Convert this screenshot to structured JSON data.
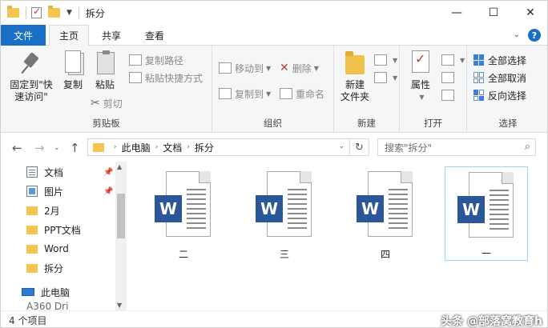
{
  "window": {
    "title": "拆分",
    "controls": {
      "minimize": "—",
      "maximize": "☐",
      "close": "✕"
    }
  },
  "tabs": [
    {
      "label": "文件",
      "active": false
    },
    {
      "label": "主页",
      "active": true
    },
    {
      "label": "共享",
      "active": false
    },
    {
      "label": "查看",
      "active": false
    }
  ],
  "ribbon": {
    "clipboard": {
      "label": "剪贴板",
      "pin_quick": "固定到\"快\n速访问\"",
      "copy": "复制",
      "paste": "粘贴",
      "copy_path": "复制路径",
      "paste_shortcut": "粘贴快捷方式",
      "cut": "剪切"
    },
    "organize": {
      "label": "组织",
      "move_to": "移动到",
      "copy_to": "复制到",
      "delete": "删除",
      "rename": "重命名"
    },
    "new": {
      "label": "新建",
      "new_folder": "新建\n文件夹"
    },
    "open": {
      "label": "打开",
      "properties": "属性"
    },
    "select": {
      "label": "选择",
      "select_all": "全部选择",
      "select_none": "全部取消",
      "invert": "反向选择"
    }
  },
  "address": {
    "crumbs": [
      "此电脑",
      "文档",
      "拆分"
    ],
    "search_placeholder": "搜索\"拆分\""
  },
  "nav_pane": {
    "items": [
      {
        "label": "文档",
        "icon": "document-icon",
        "pinned": true
      },
      {
        "label": "图片",
        "icon": "picture-icon",
        "pinned": true
      },
      {
        "label": "2月",
        "icon": "folder-icon",
        "pinned": false
      },
      {
        "label": "PPT文档",
        "icon": "folder-icon",
        "pinned": false
      },
      {
        "label": "Word",
        "icon": "folder-icon",
        "pinned": false
      },
      {
        "label": "拆分",
        "icon": "folder-icon",
        "pinned": false
      }
    ],
    "this_pc": "此电脑",
    "partial": "A360 Dri"
  },
  "files": [
    {
      "name": "二",
      "selected": false
    },
    {
      "name": "三",
      "selected": false
    },
    {
      "name": "四",
      "selected": false
    },
    {
      "name": "一",
      "selected": true
    }
  ],
  "status": {
    "count": "4 个项目",
    "watermark": "头条 @部落窝教育h"
  },
  "colors": {
    "accent": "#1a6fc7",
    "word": "#2b579a",
    "folder": "#f4c64f"
  }
}
